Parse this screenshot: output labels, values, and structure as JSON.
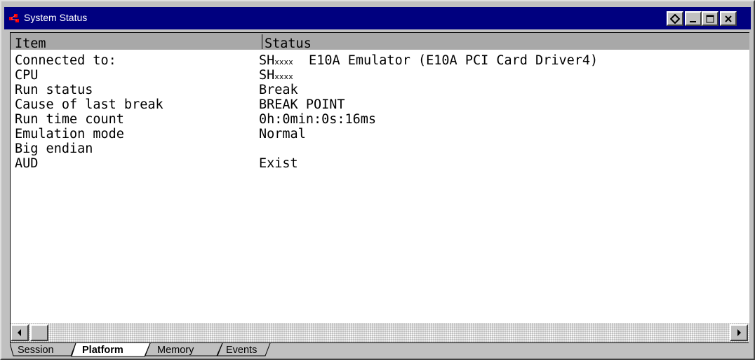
{
  "window": {
    "title": "System Status"
  },
  "table": {
    "headers": [
      "Item",
      "Status"
    ],
    "rows": [
      {
        "item": "Connected to:",
        "status_prefix": "SH",
        "status_small": "xxxx",
        "status": "  E10A Emulator (E10A PCI Card Driver4)"
      },
      {
        "item": "CPU",
        "status_prefix": "SH",
        "status_small": "xxxx",
        "status": ""
      },
      {
        "item": "Run status",
        "status_prefix": "",
        "status_small": "",
        "status": "Break"
      },
      {
        "item": "Cause of last break",
        "status_prefix": "",
        "status_small": "",
        "status": "BREAK POINT"
      },
      {
        "item": "Run time count",
        "status_prefix": "",
        "status_small": "",
        "status": "0h:0min:0s:16ms"
      },
      {
        "item": "Emulation mode",
        "status_prefix": "",
        "status_small": "",
        "status": "Normal"
      },
      {
        "item": "Big endian",
        "status_prefix": "",
        "status_small": "",
        "status": ""
      },
      {
        "item": "AUD",
        "status_prefix": "",
        "status_small": "",
        "status": "Exist"
      }
    ]
  },
  "tabs": [
    {
      "label": "Session",
      "active": false
    },
    {
      "label": "Platform",
      "active": true
    },
    {
      "label": "Memory",
      "active": false
    },
    {
      "label": "Events",
      "active": false
    }
  ],
  "colors": {
    "titlebar": "#00007f",
    "header": "#a8a8a8",
    "face": "#c0c0c0"
  }
}
